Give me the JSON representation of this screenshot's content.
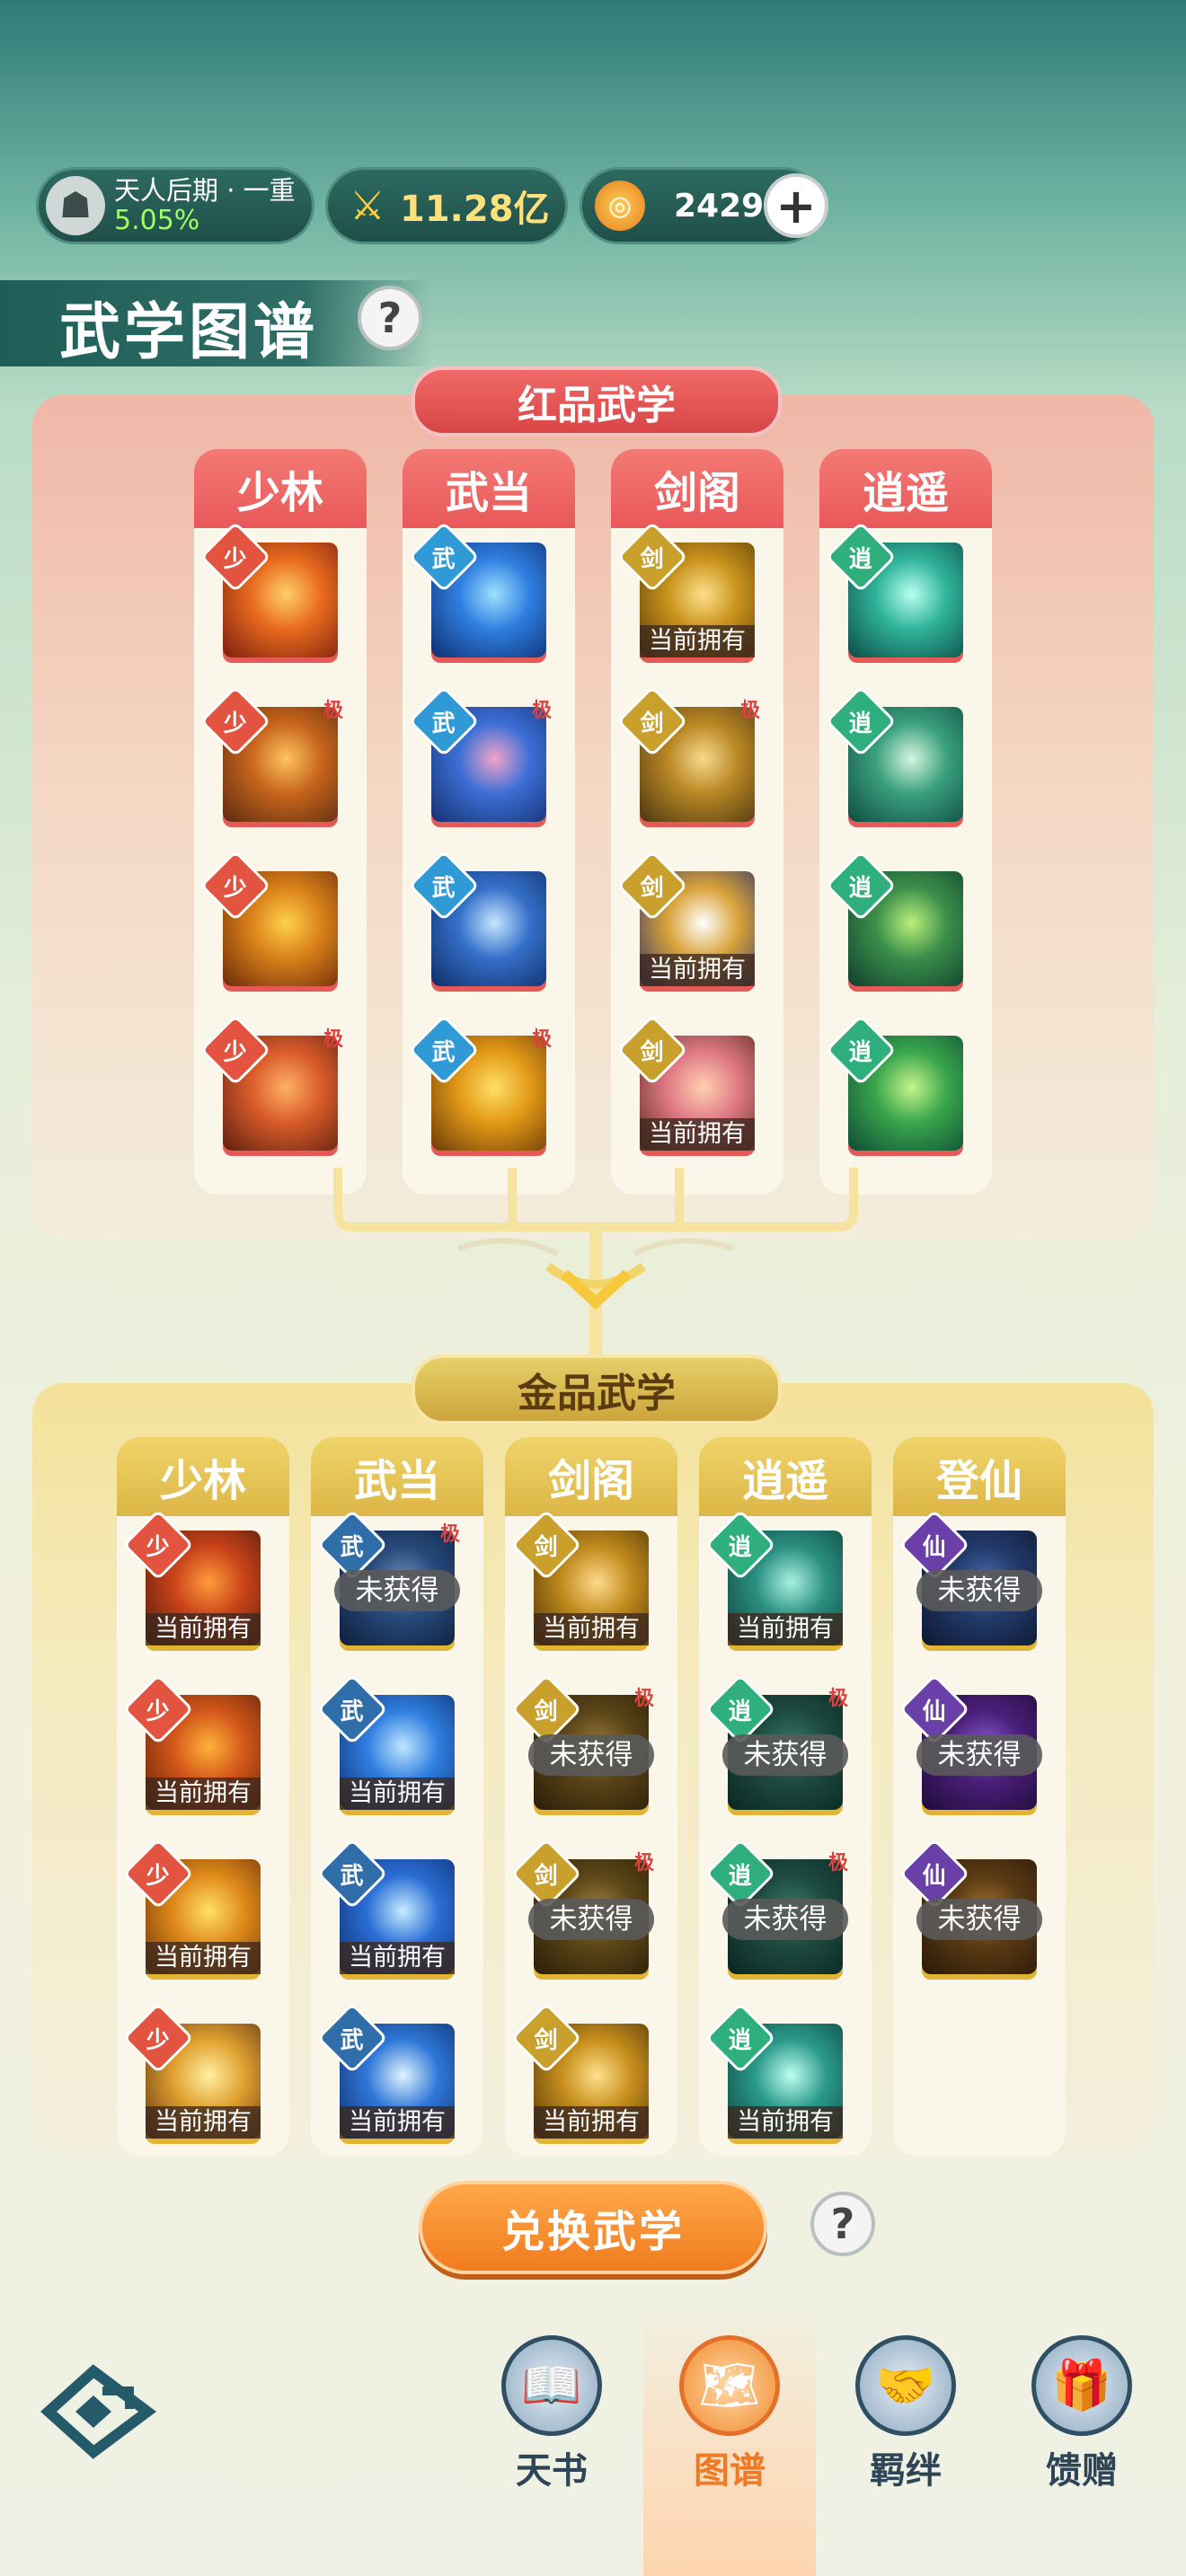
{
  "status": {
    "rank_title": "天人后期 · 一重",
    "rank_percent": "5.05%",
    "power": "11.28亿",
    "coins": "2429"
  },
  "header": {
    "title": "武学图谱"
  },
  "red_section": {
    "title": "红品武学",
    "columns": [
      {
        "name": "少林",
        "badge": "少",
        "badge_color": "#e2543f",
        "tiles": [
          {
            "colors": [
              "#7a1d0e",
              "#e86a1e",
              "#ffd06a"
            ],
            "own": "",
            "locked": "",
            "ji": ""
          },
          {
            "colors": [
              "#5a2a10",
              "#c7651c",
              "#ffc35e"
            ],
            "own": "",
            "locked": "",
            "ji": "极"
          },
          {
            "colors": [
              "#6a2a08",
              "#d9811a",
              "#ffd24a"
            ],
            "own": "",
            "locked": "",
            "ji": ""
          },
          {
            "colors": [
              "#5d1e10",
              "#d95c2a",
              "#ffb066"
            ],
            "own": "",
            "locked": "",
            "ji": "极"
          }
        ]
      },
      {
        "name": "武当",
        "badge": "武",
        "badge_color": "#2f9ad6",
        "tiles": [
          {
            "colors": [
              "#0d2e6e",
              "#2f7ee0",
              "#9fe0ff"
            ],
            "own": "",
            "locked": "",
            "ji": ""
          },
          {
            "colors": [
              "#16306e",
              "#3b6fd6",
              "#f2a4c8"
            ],
            "own": "",
            "locked": "",
            "ji": "极"
          },
          {
            "colors": [
              "#0f2c66",
              "#3570c9",
              "#c5e6ff"
            ],
            "own": "",
            "locked": "",
            "ji": ""
          },
          {
            "colors": [
              "#6b3a07",
              "#e39a17",
              "#ffe066"
            ],
            "own": "",
            "locked": "",
            "ji": "极"
          }
        ]
      },
      {
        "name": "剑阁",
        "badge": "剑",
        "badge_color": "#c9a02b",
        "tiles": [
          {
            "colors": [
              "#5a3a08",
              "#c8921c",
              "#ffe08a"
            ],
            "own": "当前拥有",
            "locked": "",
            "ji": ""
          },
          {
            "colors": [
              "#4a3510",
              "#b98724",
              "#f6d98c"
            ],
            "own": "",
            "locked": "",
            "ji": "极"
          },
          {
            "colors": [
              "#2a2f6a",
              "#d9a33a",
              "#ffffff"
            ],
            "own": "当前拥有",
            "locked": "",
            "ji": ""
          },
          {
            "colors": [
              "#5a2a1a",
              "#e07a86",
              "#ffd0b0"
            ],
            "own": "当前拥有",
            "locked": "",
            "ji": ""
          }
        ]
      },
      {
        "name": "逍遥",
        "badge": "逍",
        "badge_color": "#2fae7e",
        "tiles": [
          {
            "colors": [
              "#0d4a44",
              "#2fb39a",
              "#b8fff0"
            ],
            "own": "",
            "locked": "",
            "ji": ""
          },
          {
            "colors": [
              "#0f4a40",
              "#3aa07e",
              "#d6f6e0"
            ],
            "own": "",
            "locked": "",
            "ji": ""
          },
          {
            "colors": [
              "#0f3e2e",
              "#3b8f4a",
              "#b9f07a"
            ],
            "own": "",
            "locked": "",
            "ji": ""
          },
          {
            "colors": [
              "#0e4a36",
              "#3aa64c",
              "#c6f48a"
            ],
            "own": "",
            "locked": "",
            "ji": ""
          }
        ]
      }
    ]
  },
  "gold_section": {
    "title": "金品武学",
    "columns": [
      {
        "name": "少林",
        "badge": "少",
        "badge_color": "#e2543f",
        "tiles": [
          {
            "colors": [
              "#4a1a08",
              "#c9421a",
              "#ff9b3a"
            ],
            "own": "当前拥有",
            "locked": "",
            "ji": ""
          },
          {
            "colors": [
              "#5a2008",
              "#d3571a",
              "#ffb23a"
            ],
            "own": "当前拥有",
            "locked": "",
            "ji": ""
          },
          {
            "colors": [
              "#6a3008",
              "#e08a1a",
              "#ffe066"
            ],
            "own": "当前拥有",
            "locked": "",
            "ji": ""
          },
          {
            "colors": [
              "#5a3010",
              "#e0a030",
              "#fff0a0"
            ],
            "own": "当前拥有",
            "locked": "",
            "ji": ""
          }
        ]
      },
      {
        "name": "武当",
        "badge": "武",
        "badge_color": "#2f6ea8",
        "tiles": [
          {
            "colors": [
              "#0d1e3a",
              "#27497a",
              "#6f8fb8"
            ],
            "own": "",
            "locked": "未获得",
            "ji": "极"
          },
          {
            "colors": [
              "#0e2e6e",
              "#2f7ee0",
              "#bfe6ff"
            ],
            "own": "当前拥有",
            "locked": "",
            "ji": ""
          },
          {
            "colors": [
              "#0d2c6a",
              "#2b6ed6",
              "#c5ecff"
            ],
            "own": "当前拥有",
            "locked": "",
            "ji": ""
          },
          {
            "colors": [
              "#0d2a66",
              "#2f78d8",
              "#e0f4ff"
            ],
            "own": "当前拥有",
            "locked": "",
            "ji": ""
          }
        ]
      },
      {
        "name": "剑阁",
        "badge": "剑",
        "badge_color": "#c9a02b",
        "tiles": [
          {
            "colors": [
              "#4a3008",
              "#c08a1c",
              "#ffd98a"
            ],
            "own": "当前拥有",
            "locked": "",
            "ji": ""
          },
          {
            "colors": [
              "#2a1e08",
              "#5a4418",
              "#9a7a3a"
            ],
            "own": "",
            "locked": "未获得",
            "ji": "极"
          },
          {
            "colors": [
              "#2a1e08",
              "#5c4618",
              "#a0803c"
            ],
            "own": "",
            "locked": "未获得",
            "ji": "极"
          },
          {
            "colors": [
              "#4a3008",
              "#c68e1c",
              "#ffe08a"
            ],
            "own": "当前拥有",
            "locked": "",
            "ji": ""
          }
        ]
      },
      {
        "name": "逍遥",
        "badge": "逍",
        "badge_color": "#2fae7e",
        "tiles": [
          {
            "colors": [
              "#0d3e3a",
              "#2a8f80",
              "#a8f0e0"
            ],
            "own": "当前拥有",
            "locked": "",
            "ji": ""
          },
          {
            "colors": [
              "#0a2622",
              "#1e4a40",
              "#3a7a68"
            ],
            "own": "",
            "locked": "未获得",
            "ji": "极"
          },
          {
            "colors": [
              "#0a2622",
              "#1e4a40",
              "#3a7a68"
            ],
            "own": "",
            "locked": "未获得",
            "ji": "极"
          },
          {
            "colors": [
              "#0d3e3a",
              "#2a9a8a",
              "#c0fff0"
            ],
            "own": "当前拥有",
            "locked": "",
            "ji": ""
          }
        ]
      },
      {
        "name": "登仙",
        "badge": "仙",
        "badge_color": "#6a3fa8",
        "tiles": [
          {
            "colors": [
              "#0d1630",
              "#223a6a",
              "#4a6ab0"
            ],
            "own": "",
            "locked": "未获得",
            "ji": ""
          },
          {
            "colors": [
              "#1e0d36",
              "#4a1e7a",
              "#8a5ad0"
            ],
            "own": "",
            "locked": "未获得",
            "ji": ""
          },
          {
            "colors": [
              "#2a1808",
              "#5a3a14",
              "#a0702a"
            ],
            "own": "",
            "locked": "未获得",
            "ji": ""
          }
        ]
      }
    ]
  },
  "actions": {
    "exchange_label": "兑换武学"
  },
  "nav": {
    "items": [
      {
        "label": "天书",
        "icon": "book-icon",
        "glyph": "📖"
      },
      {
        "label": "图谱",
        "icon": "map-icon",
        "glyph": "🗺"
      },
      {
        "label": "羁绊",
        "icon": "handshake-icon",
        "glyph": "🤝"
      },
      {
        "label": "馈赠",
        "icon": "gift-icon",
        "glyph": "🎁"
      }
    ],
    "active_index": 1
  },
  "help_glyph": "?"
}
